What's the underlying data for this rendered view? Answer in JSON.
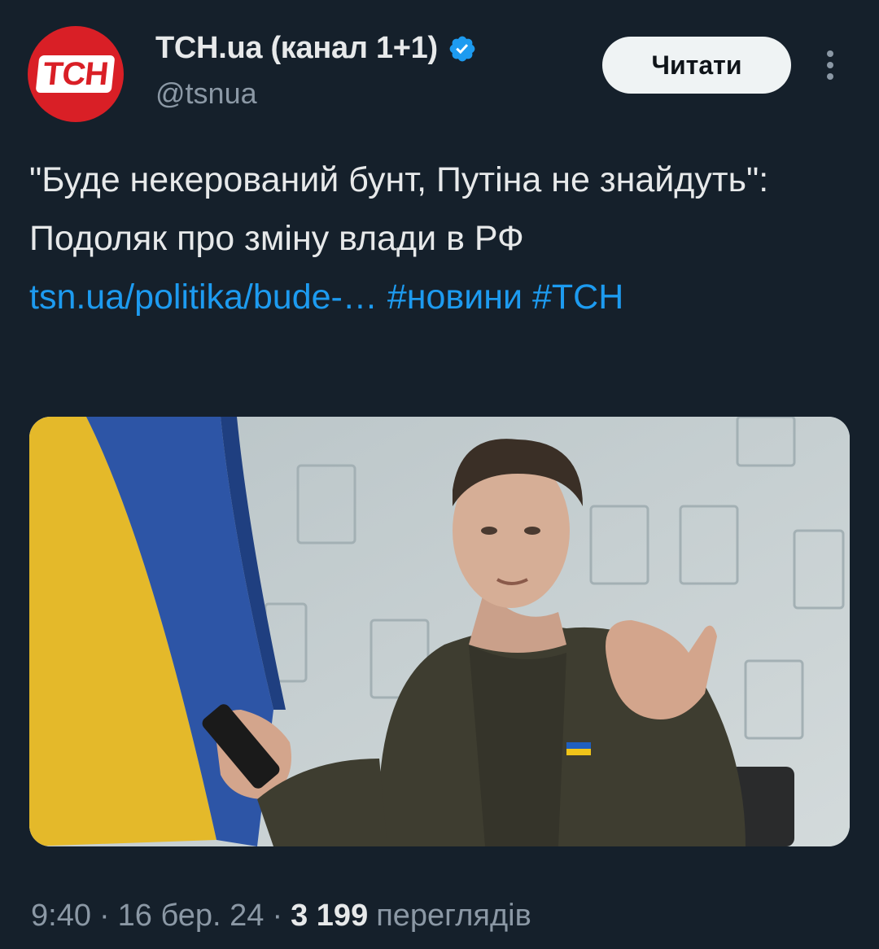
{
  "account": {
    "avatar_text": "ТСН",
    "display_name": "ТСН.ua (канал 1+1)",
    "verified_icon": "verified-badge-icon",
    "handle": "@tsnua"
  },
  "actions": {
    "follow_label": "Читати",
    "more_icon": "more-vertical-icon"
  },
  "tweet": {
    "text": "\"Буде некерований бунт, Путіна не знайдуть\": Подоляк про зміну влади в РФ ",
    "link": "tsn.ua/politika/bude-…",
    "hashtag1": "#новини",
    "hashtag2": "#ТСН"
  },
  "media": {
    "description_icon": "photo"
  },
  "meta": {
    "time": "9:40",
    "sep1": "·",
    "date": "16 бер. 24",
    "sep2": "·",
    "views_count": "3 199",
    "views_label": "переглядів"
  },
  "colors": {
    "background": "#15202b",
    "link": "#1d9bf0",
    "secondary_text": "#8b98a5",
    "avatar": "#d91f26"
  }
}
